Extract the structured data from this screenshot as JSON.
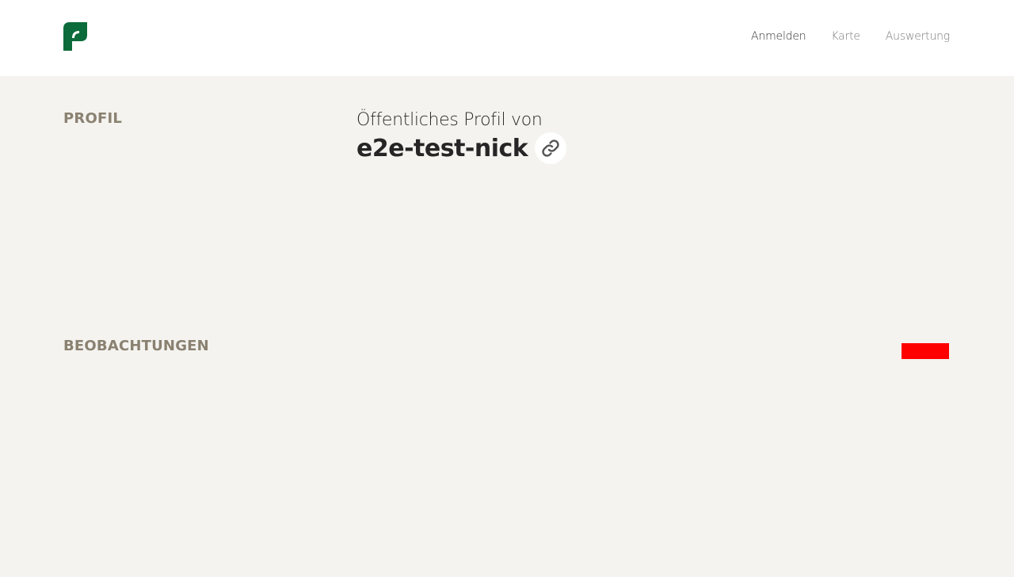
{
  "header": {
    "logo_icon": "leaf-p-logo",
    "logo_color": "#0b6b3a",
    "nav": [
      {
        "label": "Anmelden",
        "active": true
      },
      {
        "label": "Karte",
        "active": false
      },
      {
        "label": "Auswertung",
        "active": false
      }
    ]
  },
  "profile": {
    "section_title": "PROFIL",
    "subtitle": "Öffentliches Profil von",
    "nickname": "e2e-test-nick",
    "link_icon": "link-icon"
  },
  "observations": {
    "section_title": "BEOBACHTUNGEN",
    "marker_color": "#ff0000"
  },
  "colors": {
    "background": "#f4f3ef",
    "section_title": "#8a8171"
  }
}
